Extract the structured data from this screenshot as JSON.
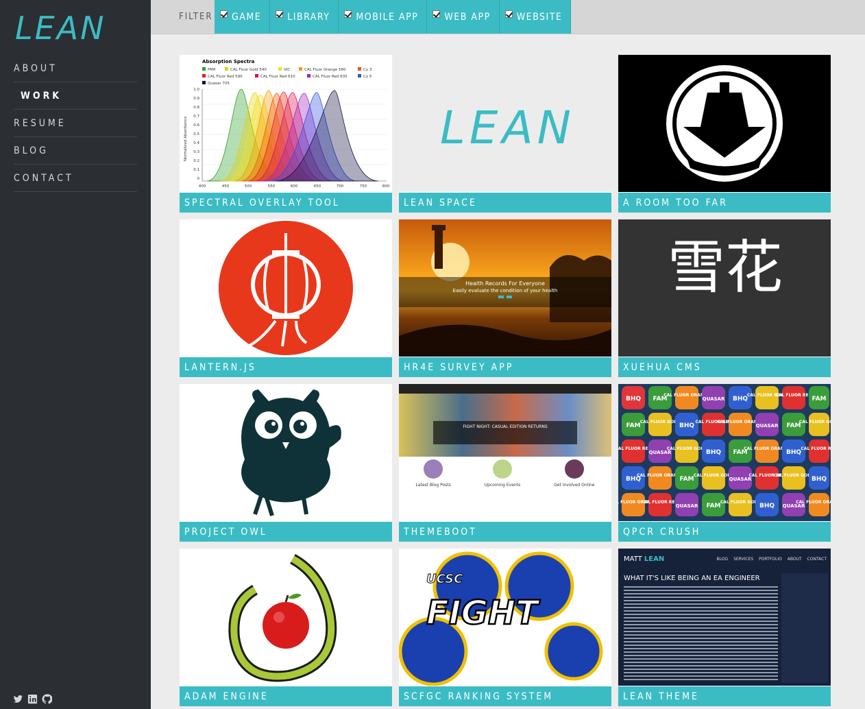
{
  "brand": {
    "logo": "LEAN"
  },
  "nav": {
    "items": [
      {
        "label": "ABOUT",
        "active": false
      },
      {
        "label": "WORK",
        "active": true
      },
      {
        "label": "RESUME",
        "active": false
      },
      {
        "label": "BLOG",
        "active": false
      },
      {
        "label": "CONTACT",
        "active": false
      }
    ]
  },
  "social": [
    "twitter-icon",
    "linkedin-icon",
    "github-icon"
  ],
  "filter": {
    "label": "FILTER",
    "options": [
      "GAME",
      "LIBRARY",
      "MOBILE APP",
      "WEB APP",
      "WEBSITE"
    ]
  },
  "projects": [
    "SPECTRAL OVERLAY TOOL",
    "LEAN SPACE",
    "A ROOM TOO FAR",
    "LANTERN.JS",
    "HR4E SURVEY APP",
    "XUEHUA CMS",
    "PROJECT OWL",
    "THEMEBOOT",
    "QPCR CRUSH",
    "ADAM ENGINE",
    "SCFGC RANKING SYSTEM",
    "LEAN THEME"
  ],
  "thumbs": {
    "spectral_title": "Absorption Spectra",
    "spectral_ylabel": "Normalized Absorbance",
    "spectral_legend": [
      "FAM",
      "CAL Fluor Gold 540",
      "VIC",
      "CAL Fluor Orange 560",
      "Cy 3",
      "CAL Fluor Red 590",
      "CAL Fluor Red 610",
      "CAL Fluor Red 635",
      "Cy 5",
      "Quasar 705"
    ],
    "spectral_xticks": [
      "400",
      "450",
      "500",
      "550",
      "600",
      "650",
      "700",
      "750",
      "800"
    ],
    "spectral_yticks": [
      "1.0",
      "0.9",
      "0.8",
      "0.7",
      "0.6",
      "0.5",
      "0.4",
      "0.3",
      "0.2",
      "0.1",
      "0"
    ],
    "leanspace": "LEAN",
    "hr4e_title": "Health Records For Everyone",
    "hr4e_sub": "Easily evaluate the condition of your health",
    "xuehua": "雪花",
    "themeboot_hero": "FIGHT NIGHT: CASUAL EDITION RETURNS",
    "themeboot_cols": [
      "Latest Blog Posts",
      "Upcoming Events",
      "Get Involved Online"
    ],
    "qpcr_tiles": [
      "BHQ",
      "FAM",
      "CAL FLUOR ORANGE",
      "QUASAR",
      "CAL FLUOR GOLD",
      "CAL FLUOR RED"
    ],
    "fight_top": "UCSC",
    "fight_word": "FIGHT",
    "mattlean_brand_a": "MATT",
    "mattlean_brand_b": "LEAN",
    "mattlean_nav": "BLOG  SERVICES  PORTFOLIO  ABOUT  CONTACT",
    "mattlean_title": "WHAT IT'S LIKE BEING AN EA ENGINEER"
  }
}
